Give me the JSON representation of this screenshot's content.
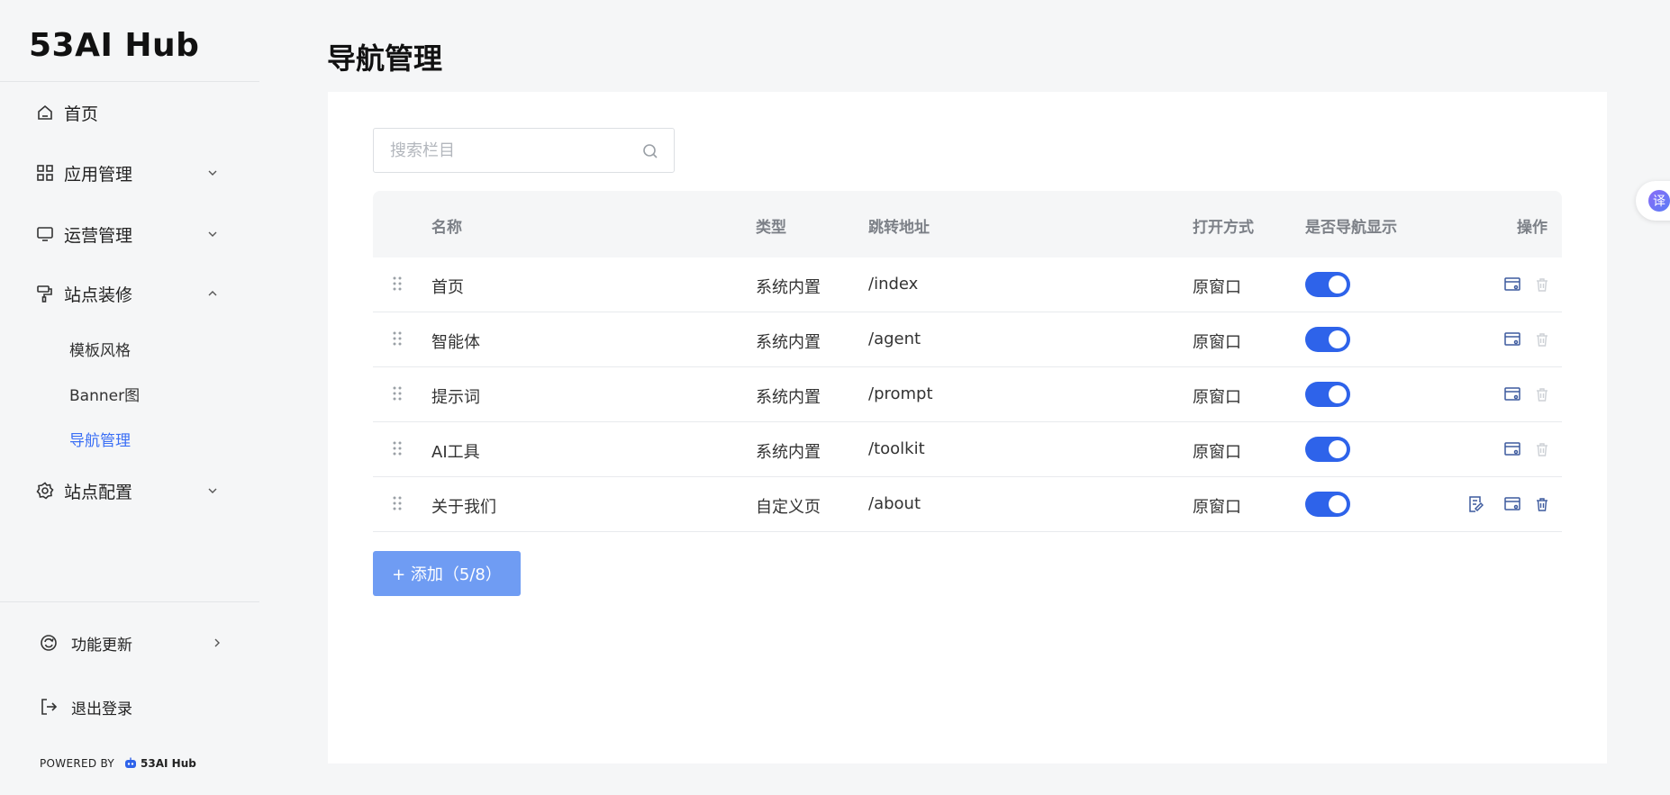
{
  "app": {
    "logo_text": "53AI Hub"
  },
  "sidebar": {
    "items": [
      {
        "label": "首页",
        "icon": "home-icon"
      },
      {
        "label": "应用管理",
        "icon": "grid-icon"
      },
      {
        "label": "运营管理",
        "icon": "monitor-icon"
      },
      {
        "label": "站点装修",
        "icon": "paint-roller-icon"
      },
      {
        "label": "站点配置",
        "icon": "gear-icon"
      }
    ],
    "submenu": [
      {
        "label": "模板风格"
      },
      {
        "label": "Banner图"
      },
      {
        "label": "导航管理",
        "active": true
      }
    ],
    "footer": {
      "update_label": "功能更新",
      "logout_label": "退出登录",
      "powered_by": "POWERED BY",
      "powered_logo": "53AI Hub"
    }
  },
  "main": {
    "title": "导航管理",
    "search": {
      "placeholder": "搜索栏目",
      "value": ""
    },
    "table": {
      "headers": [
        "名称",
        "类型",
        "跳转地址",
        "打开方式",
        "是否导航显示",
        "操作"
      ],
      "rows": [
        {
          "name": "首页",
          "type": "系统内置",
          "url": "/index",
          "open": "原窗口",
          "visible": true,
          "editable": false
        },
        {
          "name": "智能体",
          "type": "系统内置",
          "url": "/agent",
          "open": "原窗口",
          "visible": true,
          "editable": false
        },
        {
          "name": "提示词",
          "type": "系统内置",
          "url": "/prompt",
          "open": "原窗口",
          "visible": true,
          "editable": false
        },
        {
          "name": "AI工具",
          "type": "系统内置",
          "url": "/toolkit",
          "open": "原窗口",
          "visible": true,
          "editable": false
        },
        {
          "name": "关于我们",
          "type": "自定义页",
          "url": "/about",
          "open": "原窗口",
          "visible": true,
          "editable": true
        }
      ]
    },
    "add_button": "+ 添加（5/8）"
  },
  "floating": {
    "translate_label": "译"
  },
  "colors": {
    "accent": "#2e63ea",
    "active_text": "#3b6ff5",
    "add_button": "#6f9cf3"
  }
}
